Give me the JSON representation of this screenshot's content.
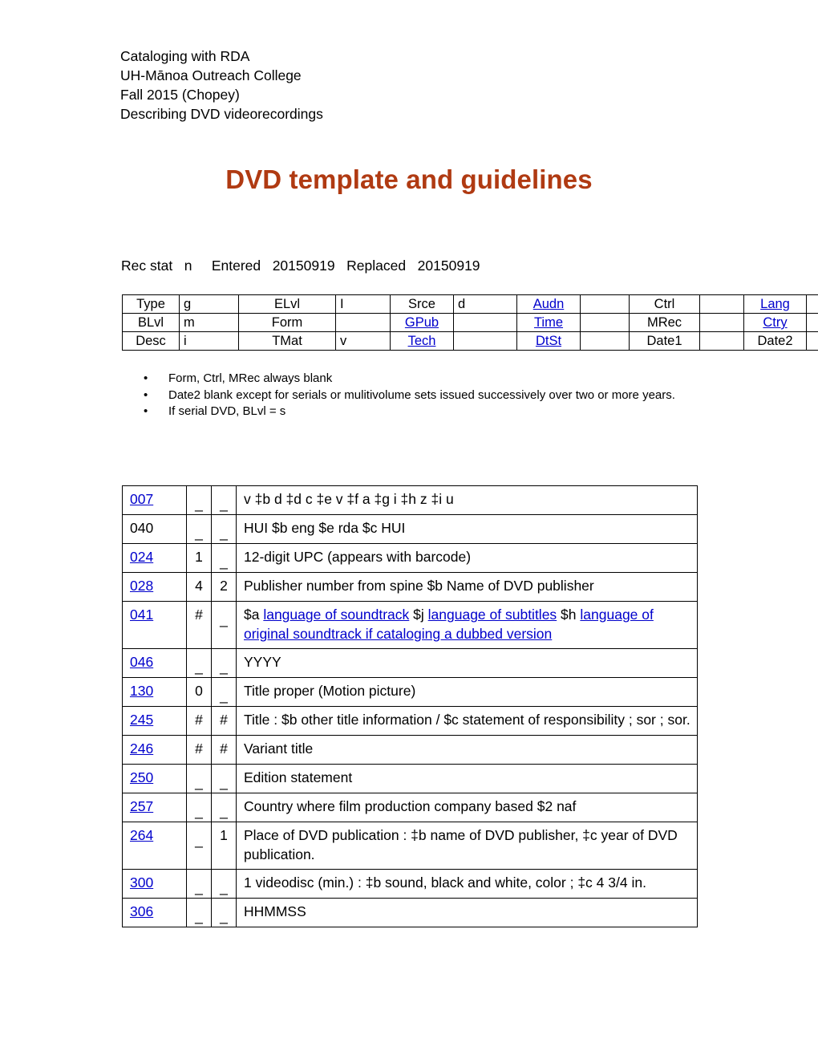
{
  "header": {
    "lines": [
      "Cataloging with RDA",
      "UH-Mānoa Outreach College",
      "Fall 2015 (Chopey)",
      "Describing DVD videorecordings"
    ]
  },
  "title": "DVD template and guidelines",
  "colors": {
    "title": "#b03a12",
    "link": "#0000cc",
    "text": "#000000",
    "border": "#000000"
  },
  "recstat": {
    "line": "Rec stat   n     Entered   20150919   Replaced   20150919",
    "rec_stat_label": "Rec stat",
    "rec_stat_value": "n",
    "entered_label": "Entered",
    "entered_value": "20150919",
    "replaced_label": "Replaced",
    "replaced_value": "20150919"
  },
  "fixed_field_table": {
    "rows": [
      [
        {
          "text": "Type",
          "link": false
        },
        {
          "text": "g",
          "link": false
        },
        {
          "text": "ELvl",
          "link": false
        },
        {
          "text": "I",
          "link": false
        },
        {
          "text": "Srce",
          "link": false
        },
        {
          "text": "d",
          "link": false
        },
        {
          "text": "Audn",
          "link": true
        },
        {
          "text": "",
          "link": false
        },
        {
          "text": "Ctrl",
          "link": false
        },
        {
          "text": "",
          "link": false
        },
        {
          "text": "Lang",
          "link": true
        },
        {
          "text": "",
          "link": false
        }
      ],
      [
        {
          "text": "BLvl",
          "link": false
        },
        {
          "text": "m",
          "link": false
        },
        {
          "text": "Form",
          "link": false
        },
        {
          "text": "",
          "link": false
        },
        {
          "text": "GPub",
          "link": true
        },
        {
          "text": "",
          "link": false
        },
        {
          "text": "Time",
          "link": true
        },
        {
          "text": "",
          "link": false
        },
        {
          "text": "MRec",
          "link": false
        },
        {
          "text": "",
          "link": false
        },
        {
          "text": "Ctry",
          "link": true
        },
        {
          "text": "",
          "link": false
        }
      ],
      [
        {
          "text": "Desc",
          "link": false
        },
        {
          "text": "i",
          "link": false
        },
        {
          "text": "TMat",
          "link": false
        },
        {
          "text": "v",
          "link": false
        },
        {
          "text": "Tech",
          "link": true
        },
        {
          "text": "",
          "link": false
        },
        {
          "text": "DtSt",
          "link": true
        },
        {
          "text": "",
          "link": false
        },
        {
          "text": "Date1",
          "link": false
        },
        {
          "text": "",
          "link": false
        },
        {
          "text": "Date2",
          "link": false
        },
        {
          "text": "",
          "link": false
        }
      ]
    ]
  },
  "bullets": [
    "Form, Ctrl, MRec always blank",
    "Date2 blank except for serials or mulitivolume sets issued successively over two or more years.",
    "If serial DVD, BLvl = s"
  ],
  "marc_table": {
    "rows": [
      {
        "tag": "007",
        "tag_link": true,
        "ind1": "_",
        "ind2": "_",
        "content": [
          {
            "text": "v ‡b d ‡d c ‡e v ‡f a ‡g i ‡h z ‡i u",
            "link": false
          }
        ]
      },
      {
        "tag": "040",
        "tag_link": false,
        "ind1": "_",
        "ind2": "_",
        "content": [
          {
            "text": "HUI $b eng $e rda $c HUI",
            "link": false
          }
        ]
      },
      {
        "tag": "024",
        "tag_link": true,
        "ind1": "1",
        "ind2": "_",
        "content": [
          {
            "text": "12-digit UPC (appears with barcode)",
            "link": false
          }
        ]
      },
      {
        "tag": "028",
        "tag_link": true,
        "ind1": "4",
        "ind2": "2",
        "content": [
          {
            "text": "Publisher number from spine $b Name of DVD publisher",
            "link": false
          }
        ]
      },
      {
        "tag": "041",
        "tag_link": true,
        "ind1": "#",
        "ind2": "_",
        "content": [
          {
            "text": "$a ",
            "link": false
          },
          {
            "text": "language of soundtrack",
            "link": true
          },
          {
            "text": " $j ",
            "link": false
          },
          {
            "text": "language of subtitles",
            "link": true
          },
          {
            "text": " $h ",
            "link": false
          },
          {
            "text": "language of original soundtrack if cataloging a dubbed version",
            "link": true
          }
        ]
      },
      {
        "tag": "046",
        "tag_link": true,
        "ind1": "_",
        "ind2": "_",
        "content": [
          {
            "text": "YYYY",
            "link": false
          }
        ]
      },
      {
        "tag": "130",
        "tag_link": true,
        "ind1": "0",
        "ind2": "_",
        "content": [
          {
            "text": "Title proper (Motion picture)",
            "link": false
          }
        ]
      },
      {
        "tag": "245",
        "tag_link": true,
        "ind1": "#",
        "ind2": "#",
        "content": [
          {
            "text": "Title : $b other title information / $c statement of responsibility ; sor ; sor.",
            "link": false
          }
        ]
      },
      {
        "tag": "246",
        "tag_link": true,
        "ind1": "#",
        "ind2": "#",
        "content": [
          {
            "text": "Variant title",
            "link": false
          }
        ]
      },
      {
        "tag": "250",
        "tag_link": true,
        "ind1": "_",
        "ind2": "_",
        "content": [
          {
            "text": "Edition statement",
            "link": false
          }
        ]
      },
      {
        "tag": "257",
        "tag_link": true,
        "ind1": "_",
        "ind2": "_",
        "content": [
          {
            "text": "Country where film production company based $2 naf",
            "link": false
          }
        ]
      },
      {
        "tag": "264",
        "tag_link": true,
        "ind1": "_",
        "ind2": "1",
        "content": [
          {
            "text": "Place of DVD publication : ‡b name of DVD publisher, ‡c year of DVD publication.",
            "link": false
          }
        ]
      },
      {
        "tag": "300",
        "tag_link": true,
        "ind1": "_",
        "ind2": "_",
        "content": [
          {
            "text": "1 videodisc (min.) : ‡b sound, black and white, color ; ‡c 4 3/4 in.",
            "link": false
          }
        ]
      },
      {
        "tag": "306",
        "tag_link": true,
        "ind1": "_",
        "ind2": "_",
        "content": [
          {
            "text": "HHMMSS",
            "link": false
          }
        ]
      }
    ]
  }
}
